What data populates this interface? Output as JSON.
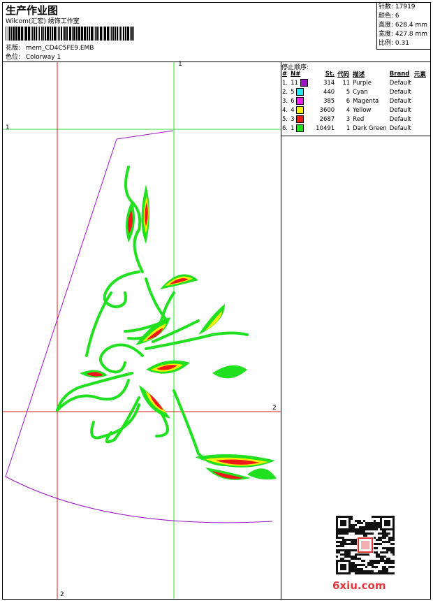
{
  "header": {
    "title": "生产作业图",
    "company": "Wilcom(汇宏) 绣饰工作室",
    "design_label": "花版:",
    "design_value": "mem_CD4C5FE9.EMB",
    "colorway_label": "色位:",
    "colorway_value": "Colorway 1"
  },
  "info": {
    "stitches": "针数: 17919",
    "colors": "颜色: 6",
    "height": "高度: 628.4 mm",
    "width": "宽度: 427.8 mm",
    "scale": "比例: 0.31"
  },
  "stop_sequence": {
    "title": "停止顺序:",
    "headers": [
      "#",
      "N#",
      "St.",
      "代码",
      "描述",
      "Brand",
      "元素"
    ],
    "rows": [
      {
        "n": "1.",
        "needle": "11",
        "color": "#9a14c8",
        "st": "314",
        "code": "11",
        "desc": "Purple",
        "brand": "Default"
      },
      {
        "n": "2.",
        "needle": "5",
        "color": "#22e8f0",
        "st": "440",
        "code": "5",
        "desc": "Cyan",
        "brand": "Default"
      },
      {
        "n": "3.",
        "needle": "6",
        "color": "#f020f0",
        "st": "385",
        "code": "6",
        "desc": "Magenta",
        "brand": "Default"
      },
      {
        "n": "4.",
        "needle": "4",
        "color": "#f8f000",
        "st": "3600",
        "code": "4",
        "desc": "Yellow",
        "brand": "Default"
      },
      {
        "n": "5.",
        "needle": "3",
        "color": "#f01818",
        "st": "2687",
        "code": "3",
        "desc": "Red",
        "brand": "Default"
      },
      {
        "n": "6.",
        "needle": "1",
        "color": "#20e020",
        "st": "10491",
        "code": "1",
        "desc": "Dark Green",
        "brand": "Default"
      }
    ]
  },
  "axes": {
    "green_top": "1",
    "green_left": "1",
    "red_right": "2",
    "red_bottom": "2"
  },
  "watermark": {
    "site": "6xiu.com",
    "qr_label": "qr-code"
  },
  "colors": {
    "outline": "#9a14c8",
    "green": "#20e020",
    "yellow": "#f8f000",
    "red": "#f01818",
    "axis_green": "#33dd33",
    "axis_red": "#e01818"
  }
}
